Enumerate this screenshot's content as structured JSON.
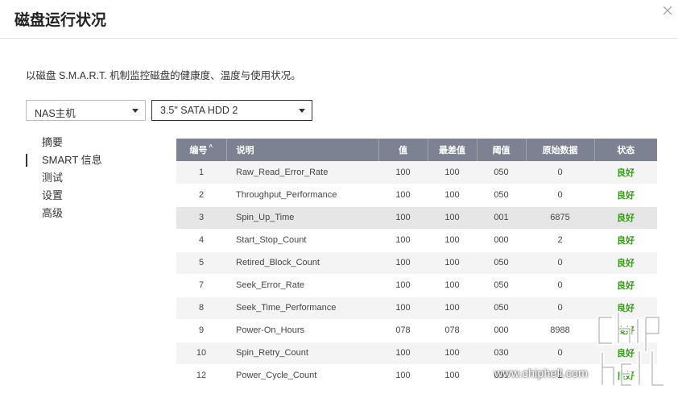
{
  "dialog": {
    "title": "磁盘运行状况",
    "description": "以磁盘 S.M.A.R.T. 机制监控磁盘的健康度、温度与使用状况。"
  },
  "selectors": {
    "host": "NAS主机",
    "disk": "3.5\" SATA HDD 2"
  },
  "nav": {
    "items": [
      {
        "label": "摘要"
      },
      {
        "label": "SMART 信息"
      },
      {
        "label": "测试"
      },
      {
        "label": "设置"
      },
      {
        "label": "高级"
      }
    ]
  },
  "table": {
    "headers": {
      "id": "编号",
      "desc": "说明",
      "value": "值",
      "worst": "最差值",
      "threshold": "阈值",
      "raw": "原始数据",
      "status": "状态"
    },
    "rows": [
      {
        "id": "1",
        "desc": "Raw_Read_Error_Rate",
        "value": "100",
        "worst": "100",
        "threshold": "050",
        "raw": "0",
        "status": "良好"
      },
      {
        "id": "2",
        "desc": "Throughput_Performance",
        "value": "100",
        "worst": "100",
        "threshold": "050",
        "raw": "0",
        "status": "良好"
      },
      {
        "id": "3",
        "desc": "Spin_Up_Time",
        "value": "100",
        "worst": "100",
        "threshold": "001",
        "raw": "6875",
        "status": "良好"
      },
      {
        "id": "4",
        "desc": "Start_Stop_Count",
        "value": "100",
        "worst": "100",
        "threshold": "000",
        "raw": "2",
        "status": "良好"
      },
      {
        "id": "5",
        "desc": "Retired_Block_Count",
        "value": "100",
        "worst": "100",
        "threshold": "050",
        "raw": "0",
        "status": "良好"
      },
      {
        "id": "7",
        "desc": "Seek_Error_Rate",
        "value": "100",
        "worst": "100",
        "threshold": "050",
        "raw": "0",
        "status": "良好"
      },
      {
        "id": "8",
        "desc": "Seek_Time_Performance",
        "value": "100",
        "worst": "100",
        "threshold": "050",
        "raw": "0",
        "status": "良好"
      },
      {
        "id": "9",
        "desc": "Power-On_Hours",
        "value": "078",
        "worst": "078",
        "threshold": "000",
        "raw": "8988",
        "status": "良好"
      },
      {
        "id": "10",
        "desc": "Spin_Retry_Count",
        "value": "100",
        "worst": "100",
        "threshold": "030",
        "raw": "0",
        "status": "良好"
      },
      {
        "id": "12",
        "desc": "Power_Cycle_Count",
        "value": "100",
        "worst": "100",
        "threshold": "000",
        "raw": "2",
        "status": "良好"
      }
    ]
  },
  "watermark": {
    "text": "www.chiphell.com",
    "logo_text": "chip hell"
  },
  "colors": {
    "header_bg": "#7c8292",
    "status_good": "#3a9a1d"
  }
}
